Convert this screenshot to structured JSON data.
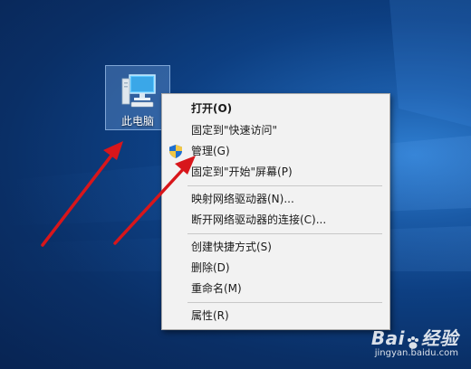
{
  "desktop": {
    "icon_label": "此电脑",
    "icon_name": "computer-icon",
    "background_color": "#0d3f82"
  },
  "context_menu": {
    "items": [
      {
        "label": "打开(O)",
        "bold": true
      },
      {
        "label": "固定到\"快速访问\""
      },
      {
        "label": "管理(G)",
        "icon": "uac-shield-icon"
      },
      {
        "label": "固定到\"开始\"屏幕(P)"
      },
      {
        "label": "映射网络驱动器(N)..."
      },
      {
        "label": "断开网络驱动器的连接(C)..."
      },
      {
        "label": "创建快捷方式(S)"
      },
      {
        "label": "删除(D)"
      },
      {
        "label": "重命名(M)"
      },
      {
        "label": "属性(R)"
      }
    ]
  },
  "annotations": {
    "arrow_color": "#d8161b"
  },
  "watermark": {
    "brand_left": "Bai",
    "brand_right": "经验",
    "site": "jingyan.baidu.com"
  }
}
